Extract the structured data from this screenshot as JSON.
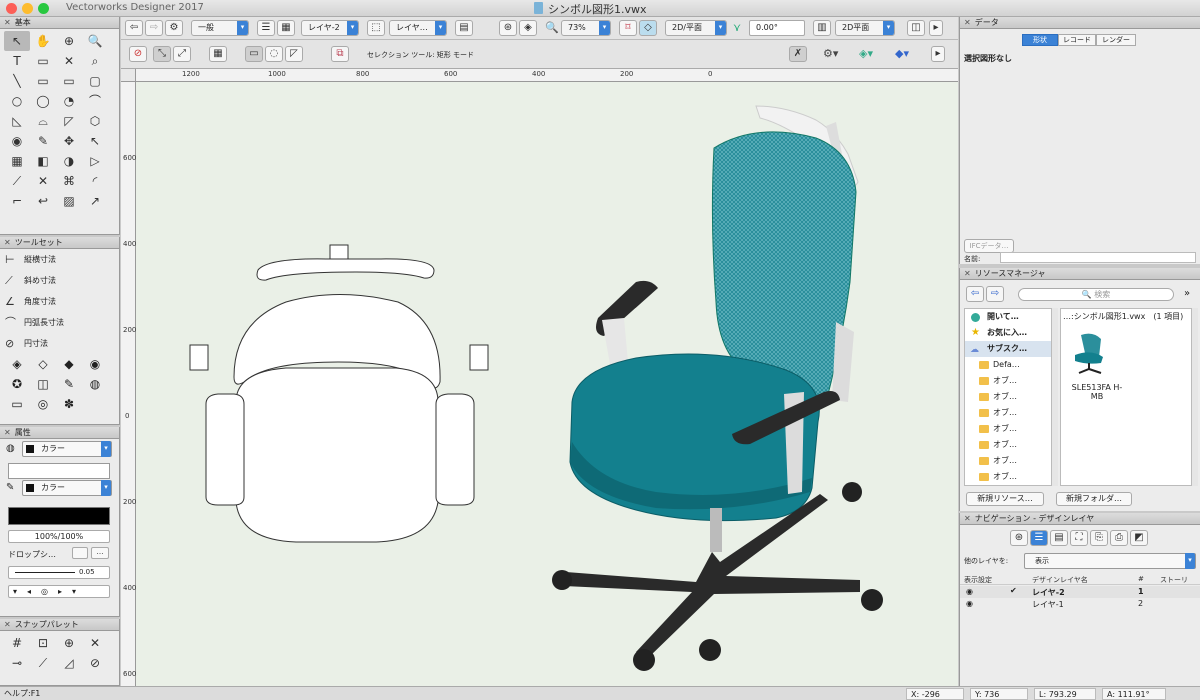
{
  "window": {
    "app_title": "Vectorworks Designer 2017",
    "doc_title": "シンボル図形1.vwx"
  },
  "toolbar": {
    "class_value": "一般",
    "layer_value": "レイヤ-2",
    "layer_mode": "レイヤ…",
    "zoom": "73%",
    "view": "2D/平面",
    "angle": "0.00°",
    "render": "2D平面"
  },
  "mode_bar": {
    "status_text": "セレクション ツール: 矩形 モード"
  },
  "ruler_h": [
    "1200",
    "1000",
    "800",
    "600",
    "400",
    "200",
    "0"
  ],
  "ruler_v": [
    "600",
    "400",
    "200",
    "0",
    "200",
    "400",
    "600"
  ],
  "palettes": {
    "basic": {
      "title": "基本",
      "tools": [
        "↖",
        "✋",
        "⊕",
        "🔍",
        "T",
        "▭",
        "✕",
        "⌕",
        "╲",
        "▭",
        "▭",
        "▢",
        "○",
        "◯",
        "◔",
        "⌒",
        "◺",
        "⌓",
        "◸",
        "⬡",
        "◉",
        "✎",
        "✥",
        "↖",
        "▦",
        "◧",
        "◑",
        "▷",
        "⟋",
        "✕",
        "⌘",
        "◜",
        "⌐",
        "↩",
        "▨",
        "↗"
      ]
    },
    "toolset": {
      "title": "ツールセット",
      "items": [
        "縦横寸法",
        "斜め寸法",
        "角度寸法",
        "円弧長寸法",
        "円寸法"
      ],
      "icons": [
        "⊢",
        "⟋",
        "∠",
        "⌒",
        "⊘"
      ],
      "grid": [
        "◈",
        "◇",
        "◆",
        "◉",
        "✪",
        "◫",
        "✎",
        "◍",
        "▭",
        "◎",
        "✽"
      ]
    },
    "attributes": {
      "title": "属性",
      "fill_label": "カラー",
      "pen_label": "カラー",
      "opacity": "100%/100%",
      "dropshadow": "ドロップシ…",
      "line_weight": "0.05"
    },
    "snap": {
      "title": "スナップパレット",
      "icons": [
        "#",
        "⊡",
        "⊕",
        "✕",
        "⊸",
        "⟋",
        "◿",
        "⊘"
      ]
    }
  },
  "data_panel": {
    "title": "データ",
    "tabs": [
      "形状",
      "レコード",
      "レンダー"
    ],
    "active_tab": "形状",
    "no_selection": "選択図形なし",
    "ifc_button": "IFCデータ…",
    "name_label": "名前:"
  },
  "resource_manager": {
    "title": "リソースマネージャ",
    "search_placeholder": "検索",
    "tree": [
      "開いて…",
      "お気に入…",
      "サブスク…",
      "Defa…",
      "オブ…",
      "オブ…",
      "オブ…",
      "オブ…",
      "オブ…",
      "オブ…",
      "オブ…"
    ],
    "file_header": "…:シンボル図形1.vwx　(1 項目)",
    "resource_name": "SLE513FA H-MB",
    "new_resource": "新規リソース…",
    "new_folder": "新規フォルダ…"
  },
  "navigation": {
    "title": "ナビゲーション - デザインレイヤ",
    "other_layers_label": "他のレイヤを:",
    "other_layers_value": "表示",
    "columns": [
      "表示設定",
      "デザインレイヤ名",
      "#",
      "ストーリ"
    ],
    "rows": [
      {
        "name": "レイヤ-2",
        "num": "1",
        "active": true
      },
      {
        "name": "レイヤ-1",
        "num": "2",
        "active": false
      }
    ]
  },
  "status_bar": {
    "help": "ヘルプ:F1",
    "x": "X: -296",
    "y": "Y: 736",
    "l": "L: 793.29",
    "a": "A: 111.91°"
  },
  "colors": {
    "accent": "#3b82d6",
    "canvas": "#eaf0e7",
    "chair_teal": "#13808e",
    "chair_black": "#2a2a2a"
  }
}
